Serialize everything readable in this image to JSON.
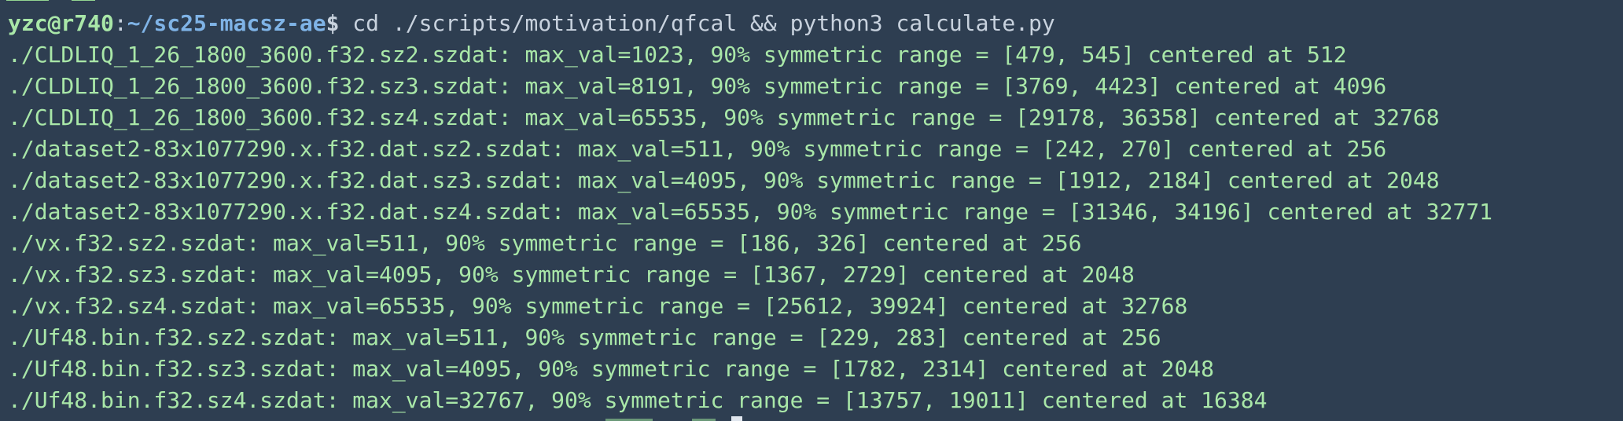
{
  "terminal": {
    "prompt": {
      "user_host": "yzc@r740",
      "separator": ":",
      "path": "~/sc25-macsz-ae",
      "symbol": "$",
      "command": " cd ./scripts/motivation/qfcal && python3 calculate.py"
    },
    "output_lines": [
      "./CLDLIQ_1_26_1800_3600.f32.sz2.szdat: max_val=1023, 90% symmetric range = [479, 545] centered at 512",
      "./CLDLIQ_1_26_1800_3600.f32.sz3.szdat: max_val=8191, 90% symmetric range = [3769, 4423] centered at 4096",
      "./CLDLIQ_1_26_1800_3600.f32.sz4.szdat: max_val=65535, 90% symmetric range = [29178, 36358] centered at 32768",
      "./dataset2-83x1077290.x.f32.dat.sz2.szdat: max_val=511, 90% symmetric range = [242, 270] centered at 256",
      "./dataset2-83x1077290.x.f32.dat.sz3.szdat: max_val=4095, 90% symmetric range = [1912, 2184] centered at 2048",
      "./dataset2-83x1077290.x.f32.dat.sz4.szdat: max_val=65535, 90% symmetric range = [31346, 34196] centered at 32771",
      "./vx.f32.sz2.szdat: max_val=511, 90% symmetric range = [186, 326] centered at 256",
      "./vx.f32.sz3.szdat: max_val=4095, 90% symmetric range = [1367, 2729] centered at 2048",
      "./vx.f32.sz4.szdat: max_val=65535, 90% symmetric range = [25612, 39924] centered at 32768",
      "./Uf48.bin.f32.sz2.szdat: max_val=511, 90% symmetric range = [229, 283] centered at 256",
      "./Uf48.bin.f32.sz3.szdat: max_val=4095, 90% symmetric range = [1782, 2314] centered at 2048",
      "./Uf48.bin.f32.sz4.szdat: max_val=32767, 90% symmetric range = [13757, 19011] centered at 16384"
    ],
    "colors": {
      "background": "#2e3e51",
      "output_text": "#a9e7a8",
      "user_host": "#a9e7a8",
      "path": "#7fb3e6",
      "command": "#c8d2de"
    }
  }
}
